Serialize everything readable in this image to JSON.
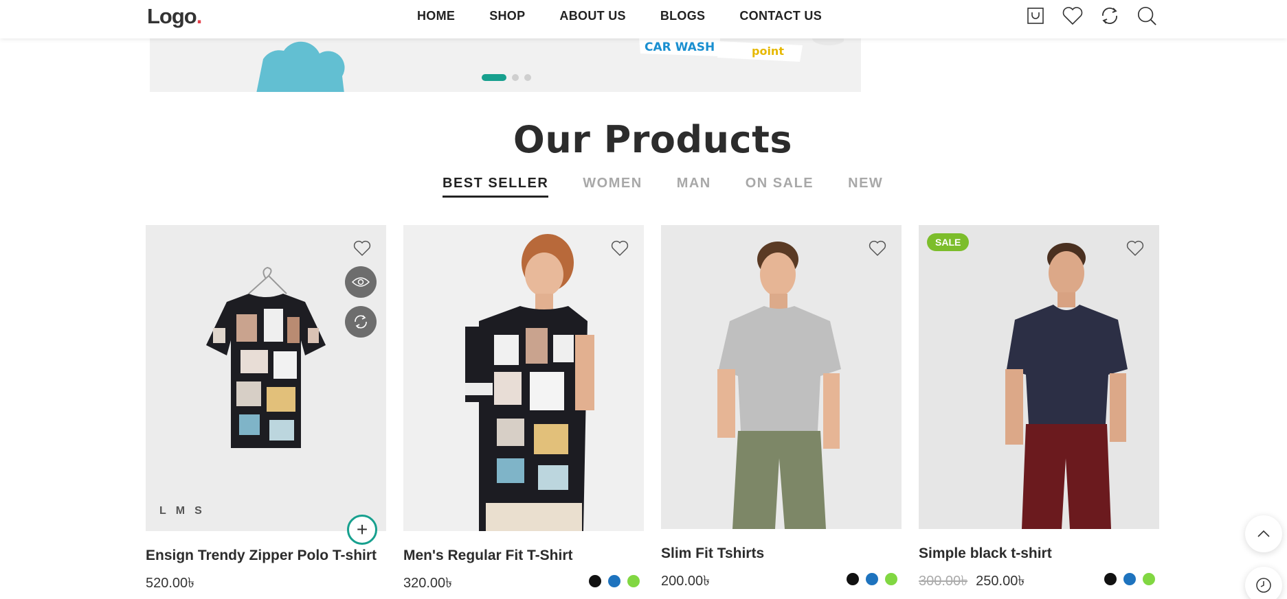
{
  "header": {
    "logo_text": "Logo",
    "logo_dot": ".",
    "nav": [
      "HOME",
      "SHOP",
      "ABOUT US",
      "BLOGS",
      "CONTACT US"
    ],
    "icons": [
      "cart-icon",
      "heart-icon",
      "compare-icon",
      "search-icon"
    ]
  },
  "banner": {
    "sticker_text_1": "CAR WASH",
    "sticker_text_2": "point",
    "slider_dots": 3,
    "active_dot": 0
  },
  "section": {
    "title": "Our Products",
    "tabs": [
      "BEST SELLER",
      "WOMEN",
      "MAN",
      "ON SALE",
      "NEW"
    ],
    "active_tab": 0
  },
  "products": [
    {
      "name": "Ensign Trendy Zipper Polo T-shirt",
      "price": "520.00৳",
      "sizes": [
        "L",
        "M",
        "S"
      ],
      "add_symbol": "+"
    },
    {
      "name": "Men's Regular Fit T-Shirt",
      "price": "320.00৳",
      "swatches": [
        "#111111",
        "#1e73be",
        "#81d742"
      ]
    },
    {
      "name": "Slim Fit Tshirts",
      "price": "200.00৳",
      "swatches": [
        "#111111",
        "#1e73be",
        "#81d742"
      ]
    },
    {
      "name": "Simple black t-shirt",
      "badge": "SALE",
      "old_price": "300.00৳",
      "price": "250.00৳",
      "swatches": [
        "#111111",
        "#1e73be",
        "#81d742"
      ]
    }
  ],
  "colors": {
    "accent": "#17a08e",
    "sale": "#7cbd2b",
    "logo_dot": "#e4404b"
  }
}
